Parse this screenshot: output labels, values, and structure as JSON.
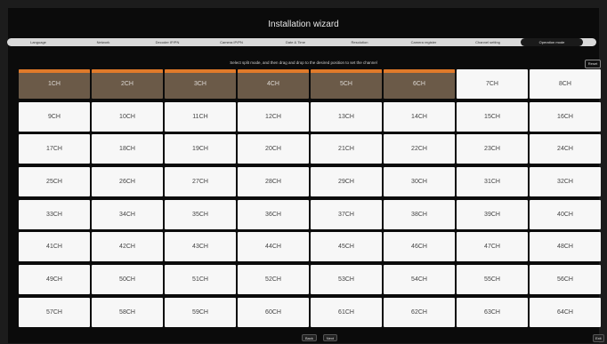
{
  "title": "Installation wizard",
  "steps": [
    {
      "label": "Language",
      "active": false
    },
    {
      "label": "Network",
      "active": false
    },
    {
      "label": "Decoder IP/PN",
      "active": false
    },
    {
      "label": "Camera IP/PN",
      "active": false
    },
    {
      "label": "Date & Time",
      "active": false
    },
    {
      "label": "Resolution",
      "active": false
    },
    {
      "label": "Camera register",
      "active": false
    },
    {
      "label": "Channel setting",
      "active": false
    },
    {
      "label": "Operation mode",
      "active": true
    }
  ],
  "instruction": "Select split mode, and then drag and drop to the desired position to set the channel",
  "reset": "Reset",
  "channels": [
    {
      "label": "1CH",
      "camera": true
    },
    {
      "label": "2CH",
      "camera": true
    },
    {
      "label": "3CH",
      "camera": true
    },
    {
      "label": "4CH",
      "camera": true
    },
    {
      "label": "5CH",
      "camera": true
    },
    {
      "label": "6CH",
      "camera": true
    },
    {
      "label": "7CH",
      "camera": false
    },
    {
      "label": "8CH",
      "camera": false
    },
    {
      "label": "9CH"
    },
    {
      "label": "10CH"
    },
    {
      "label": "11CH"
    },
    {
      "label": "12CH"
    },
    {
      "label": "13CH"
    },
    {
      "label": "14CH"
    },
    {
      "label": "15CH"
    },
    {
      "label": "16CH"
    },
    {
      "label": "17CH"
    },
    {
      "label": "18CH"
    },
    {
      "label": "19CH"
    },
    {
      "label": "20CH"
    },
    {
      "label": "21CH"
    },
    {
      "label": "22CH"
    },
    {
      "label": "23CH"
    },
    {
      "label": "24CH"
    },
    {
      "label": "25CH"
    },
    {
      "label": "26CH"
    },
    {
      "label": "27CH"
    },
    {
      "label": "28CH"
    },
    {
      "label": "29CH"
    },
    {
      "label": "30CH"
    },
    {
      "label": "31CH"
    },
    {
      "label": "32CH"
    },
    {
      "label": "33CH"
    },
    {
      "label": "34CH"
    },
    {
      "label": "35CH"
    },
    {
      "label": "36CH"
    },
    {
      "label": "37CH"
    },
    {
      "label": "38CH"
    },
    {
      "label": "39CH"
    },
    {
      "label": "40CH"
    },
    {
      "label": "41CH"
    },
    {
      "label": "42CH"
    },
    {
      "label": "43CH"
    },
    {
      "label": "44CH"
    },
    {
      "label": "45CH"
    },
    {
      "label": "46CH"
    },
    {
      "label": "47CH"
    },
    {
      "label": "48CH"
    },
    {
      "label": "49CH"
    },
    {
      "label": "50CH"
    },
    {
      "label": "51CH"
    },
    {
      "label": "52CH"
    },
    {
      "label": "53CH"
    },
    {
      "label": "54CH"
    },
    {
      "label": "55CH"
    },
    {
      "label": "56CH"
    },
    {
      "label": "57CH"
    },
    {
      "label": "58CH"
    },
    {
      "label": "59CH"
    },
    {
      "label": "60CH"
    },
    {
      "label": "61CH"
    },
    {
      "label": "62CH"
    },
    {
      "label": "63CH"
    },
    {
      "label": "64CH"
    }
  ],
  "footer": {
    "back": "Back",
    "next": "Next",
    "exit": "Exit"
  },
  "colors": {
    "accent": "#e07a2a",
    "window_bg": "#0b0b0b",
    "cell_bg": "#f7f7f7"
  }
}
